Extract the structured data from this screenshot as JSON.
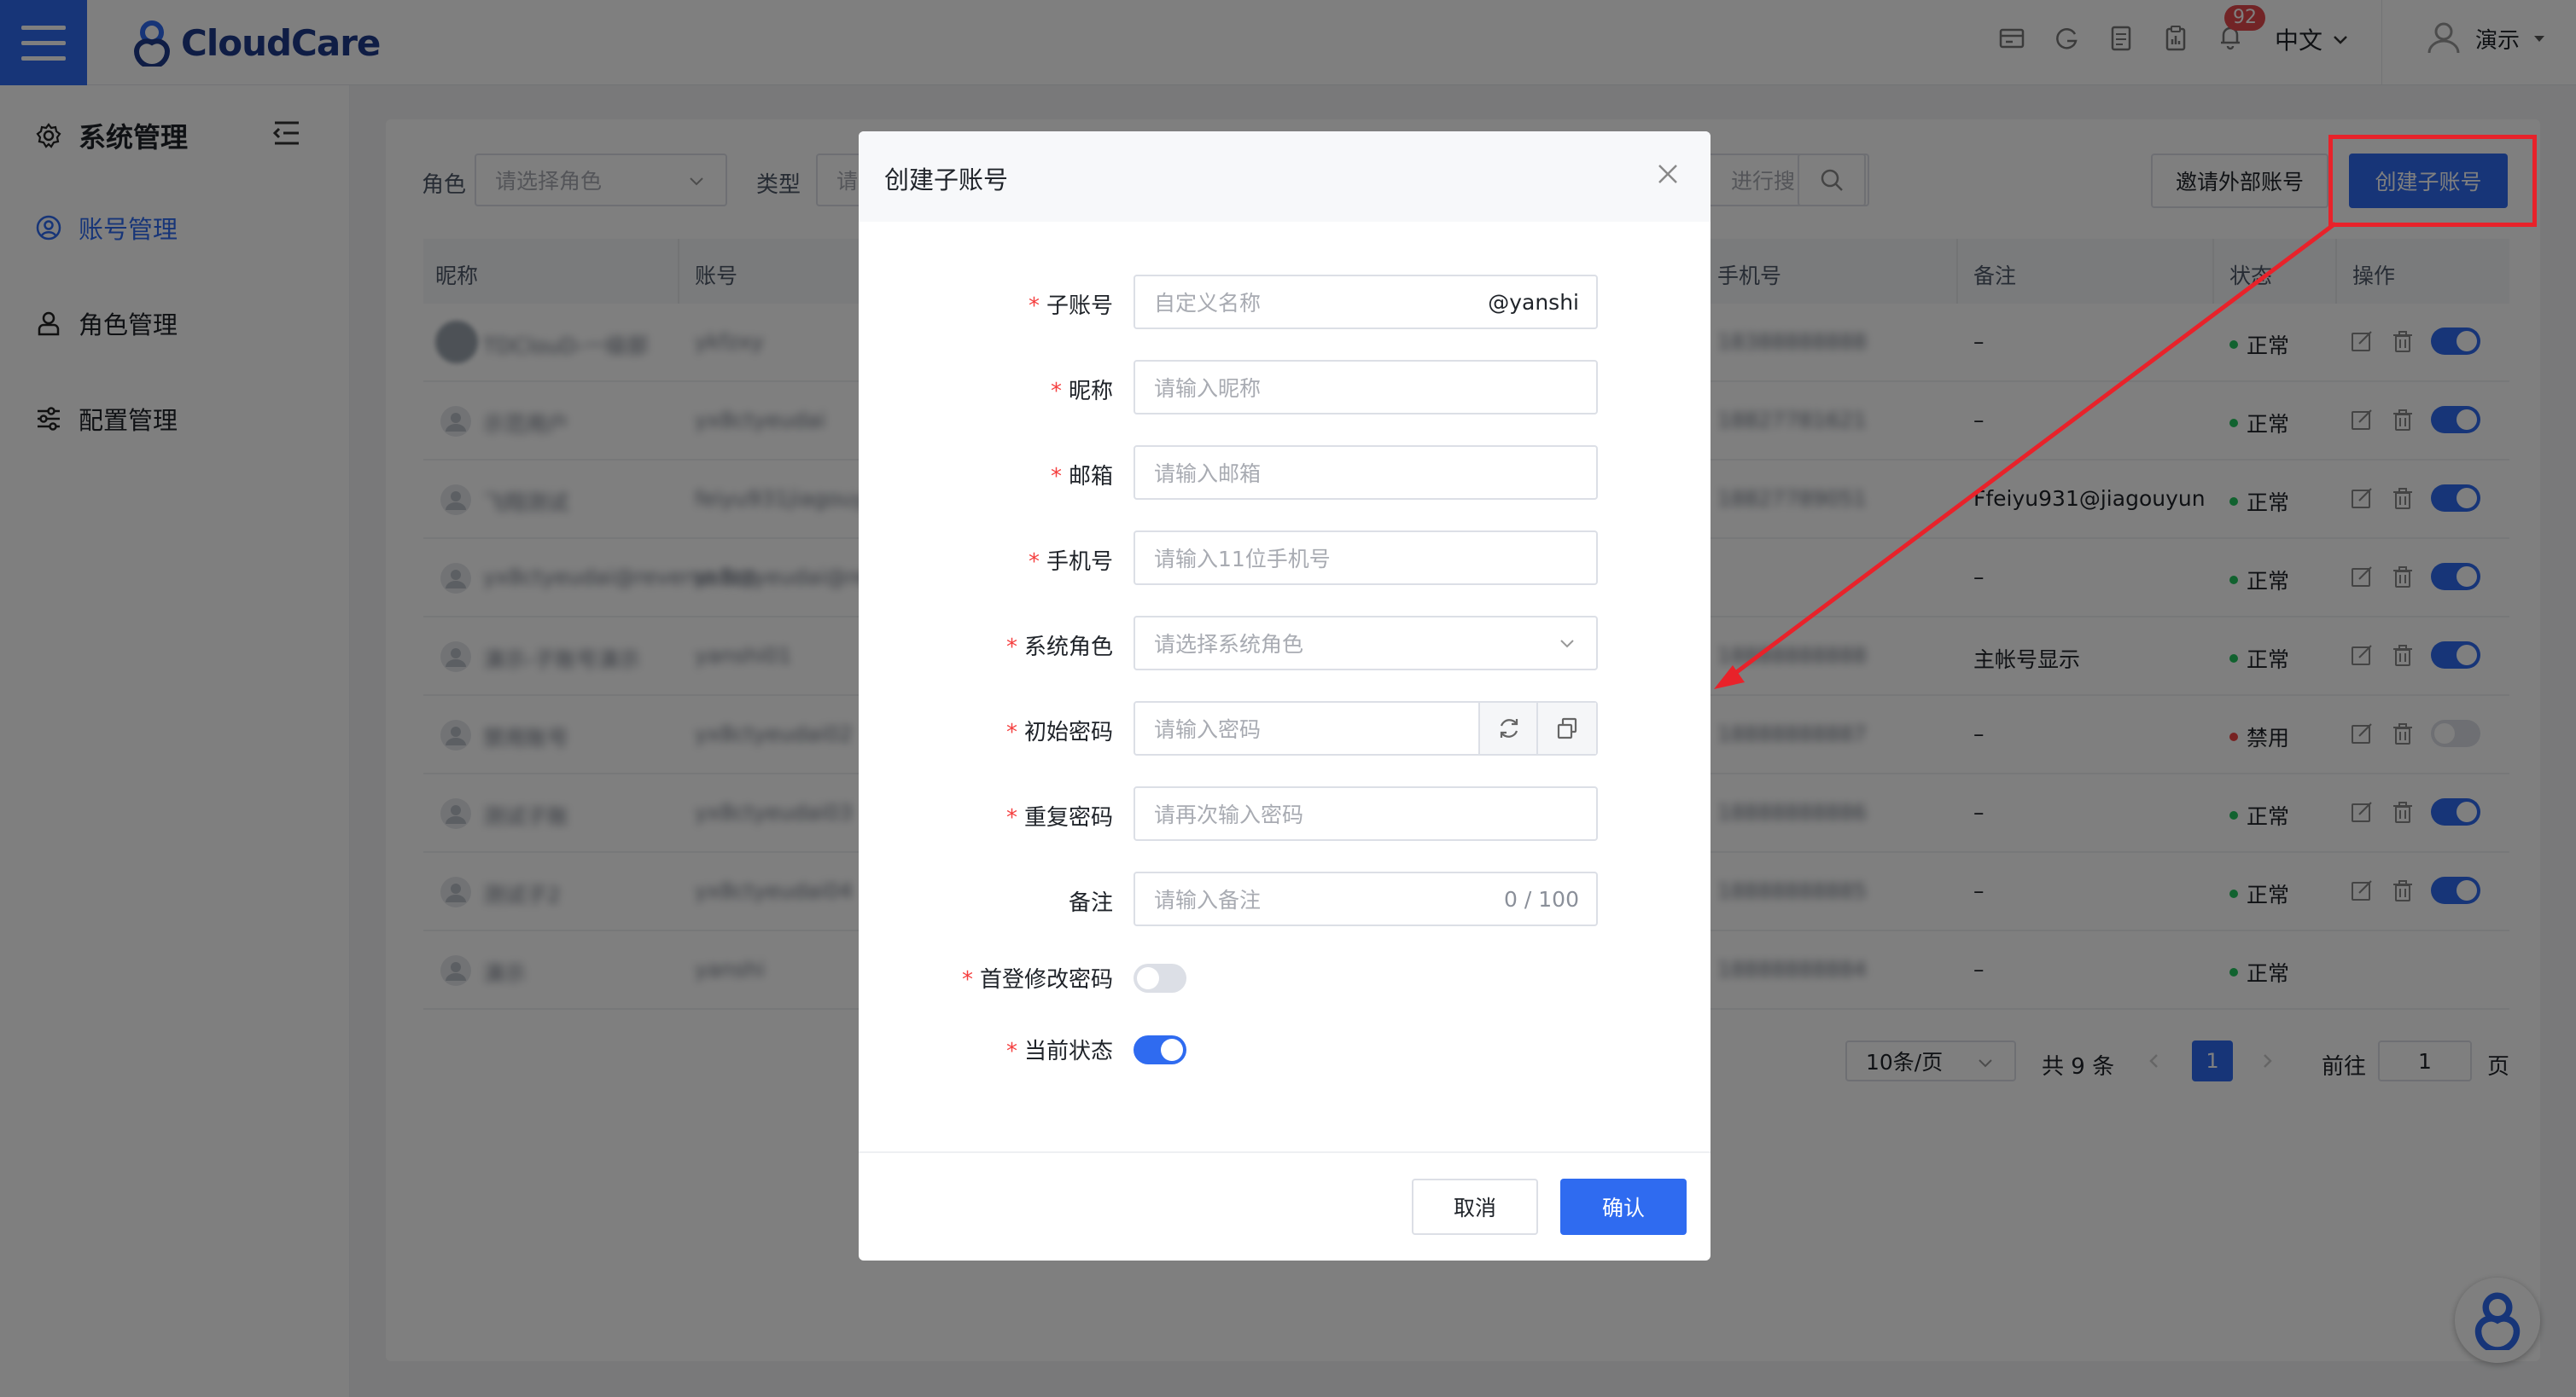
{
  "app": {
    "logo_text": "CloudCare"
  },
  "topbar": {
    "notification_count": "92",
    "language": "中文",
    "user_name": "演示"
  },
  "sidebar": {
    "title": "系统管理",
    "items": [
      {
        "label": "账号管理",
        "active": true
      },
      {
        "label": "角色管理",
        "active": false
      },
      {
        "label": "配置管理",
        "active": false
      }
    ]
  },
  "filters": {
    "role_label": "角色",
    "role_placeholder": "请选择角色",
    "type_label": "类型",
    "type_placeholder": "请",
    "search_placeholder": "进行搜"
  },
  "actions": {
    "invite_external": "邀请外部账号",
    "create_sub": "创建子账号"
  },
  "table": {
    "columns": [
      "昵称",
      "账号",
      "手机号",
      "备注",
      "状态",
      "操作"
    ],
    "rows": [
      {
        "nickname": "TDClouD-一级部",
        "account": "ykfzxy",
        "phone": "18388888888",
        "remark": "–",
        "status": "正常",
        "status_color": "#22c55e",
        "enabled": true,
        "avatar": true
      },
      {
        "nickname": "示范用户",
        "account": "yx8ctyeudai",
        "phone": "18827781621",
        "remark": "–",
        "status": "正常",
        "status_color": "#22c55e",
        "enabled": true,
        "avatar": false
      },
      {
        "nickname": "飞翔测试",
        "account": "feiyu931jiagouyun",
        "phone": "18827789051",
        "remark": "Ffeiyu931@jiagouyun....",
        "status": "正常",
        "status_color": "#22c55e",
        "enabled": true,
        "avatar": false
      },
      {
        "nickname": "yx8ctyeudai@reverse.top",
        "account": "yx8ctyeudai@reverse",
        "phone": "",
        "remark": "–",
        "status": "正常",
        "status_color": "#22c55e",
        "enabled": true,
        "avatar": false
      },
      {
        "nickname": "演示-子账号演示",
        "account": "yanshi01",
        "phone": "18888888888",
        "remark": "主帐号显示",
        "status": "正常",
        "status_color": "#22c55e",
        "enabled": true,
        "avatar": false
      },
      {
        "nickname": "禁用账号",
        "account": "yx8ctyeudai02",
        "phone": "18888888887",
        "remark": "–",
        "status": "禁用",
        "status_color": "#ef4444",
        "enabled": false,
        "avatar": false
      },
      {
        "nickname": "测试子账",
        "account": "yx8ctyeudai03",
        "phone": "18888888886",
        "remark": "–",
        "status": "正常",
        "status_color": "#22c55e",
        "enabled": true,
        "avatar": false
      },
      {
        "nickname": "测试子2",
        "account": "yx8ctyeudai04",
        "phone": "18888888885",
        "remark": "–",
        "status": "正常",
        "status_color": "#22c55e",
        "enabled": true,
        "avatar": false
      },
      {
        "nickname": "演示",
        "account": "yanshi",
        "phone": "18888888884",
        "remark": "–",
        "status": "正常",
        "status_color": "#22c55e",
        "enabled": null,
        "avatar": false
      }
    ]
  },
  "pagination": {
    "page_size": "10条/页",
    "total": "共 9 条",
    "current_page": "1",
    "goto_label": "前往",
    "goto_value": "1",
    "page_suffix": "页"
  },
  "modal": {
    "title": "创建子账号",
    "fields": [
      {
        "label": "子账号",
        "required": true,
        "placeholder": "自定义名称",
        "suffix": "@yanshi",
        "type": "text"
      },
      {
        "label": "昵称",
        "required": true,
        "placeholder": "请输入昵称",
        "type": "text"
      },
      {
        "label": "邮箱",
        "required": true,
        "placeholder": "请输入邮箱",
        "type": "text"
      },
      {
        "label": "手机号",
        "required": true,
        "placeholder": "请输入11位手机号",
        "type": "text"
      },
      {
        "label": "系统角色",
        "required": true,
        "placeholder": "请选择系统角色",
        "type": "select"
      },
      {
        "label": "初始密码",
        "required": true,
        "placeholder": "请输入密码",
        "type": "password"
      },
      {
        "label": "重复密码",
        "required": true,
        "placeholder": "请再次输入密码",
        "type": "text"
      },
      {
        "label": "备注",
        "required": false,
        "placeholder": "请输入备注",
        "count": "0 / 100",
        "type": "textarea"
      }
    ],
    "toggles": [
      {
        "label": "首登修改密码",
        "required": true,
        "on": false
      },
      {
        "label": "当前状态",
        "required": true,
        "on": true
      }
    ],
    "cancel_label": "取消",
    "confirm_label": "确认"
  },
  "colors": {
    "primary": "#2f6bf0",
    "annotation": "#e8222a"
  }
}
